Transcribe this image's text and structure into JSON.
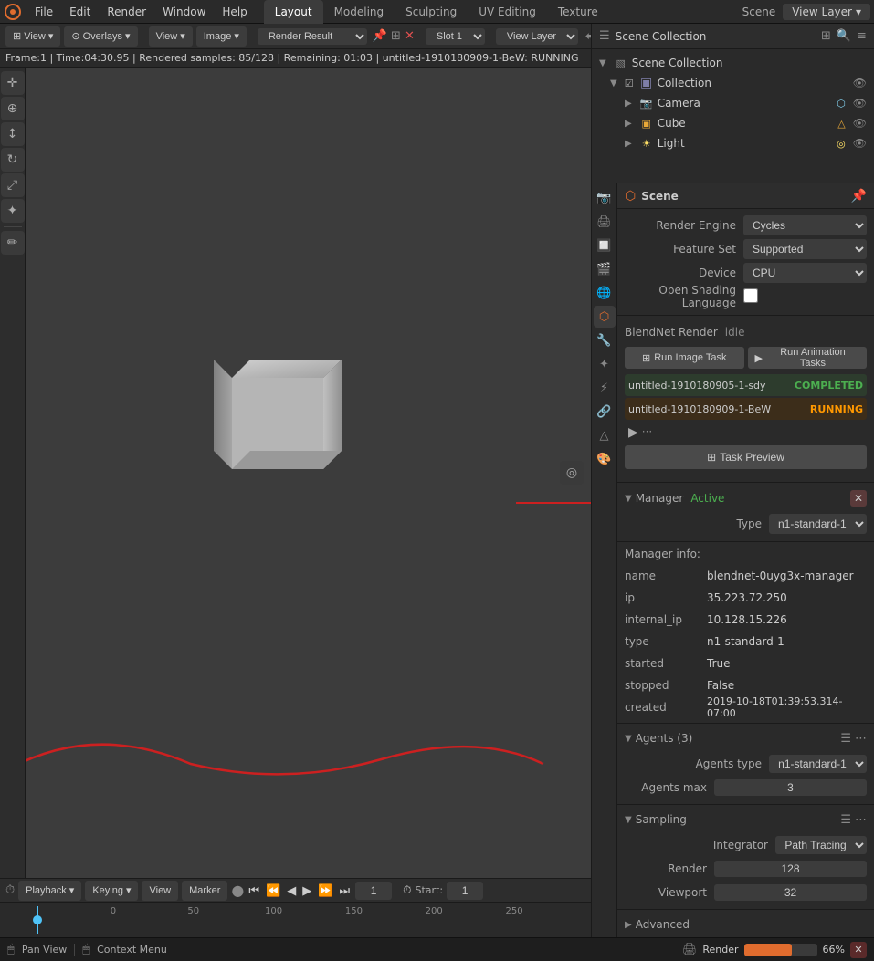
{
  "menubar": {
    "items": [
      "File",
      "Edit",
      "Render",
      "Window",
      "Help"
    ],
    "logo": "⬡",
    "workspaces": [
      {
        "label": "Layout",
        "active": true
      },
      {
        "label": "Modeling"
      },
      {
        "label": "Sculpting"
      },
      {
        "label": "UV Editing"
      },
      {
        "label": "Texture"
      },
      {
        "label": "Scene"
      }
    ],
    "view_layer": "View Layer"
  },
  "viewport": {
    "toolbar": {
      "view_btn": "View",
      "overlays_btn": "Overlays",
      "view_dropdown": "View",
      "image_btn": "Image",
      "render_result": "Render Result",
      "slot": "Slot 1",
      "view_layer": "View Layer"
    },
    "status": "Frame:1 | Time:04:30.95 | Rendered samples: 85/128 | Remaining: 01:03 | untitled-1910180909-1-BeW: RUNNING",
    "icons": [
      "🔲",
      "⚡",
      "🔍",
      "🔆"
    ]
  },
  "outliner": {
    "title": "Scene Collection",
    "items": [
      {
        "level": 1,
        "name": "Collection",
        "icon": "collection",
        "type": "folder"
      },
      {
        "level": 2,
        "name": "Camera",
        "icon": "camera",
        "type": "camera"
      },
      {
        "level": 2,
        "name": "Cube",
        "icon": "cube",
        "type": "mesh"
      },
      {
        "level": 2,
        "name": "Light",
        "icon": "light",
        "type": "light"
      }
    ]
  },
  "properties": {
    "title": "Scene",
    "sections": {
      "render": {
        "engine_label": "Render Engine",
        "engine_value": "Cycles",
        "feature_set_label": "Feature Set",
        "feature_set_value": "Supported",
        "device_label": "Device",
        "device_value": "CPU",
        "osl_label": "Open Shading Language"
      },
      "blendnet": {
        "title": "BlendNet Render",
        "status": "idle",
        "btn_image": "Run Image Task",
        "btn_animation": "Run Animation Tasks",
        "tasks": [
          {
            "name": "untitled-1910180905-1-sdy",
            "status": "COMPLETED",
            "type": "completed"
          },
          {
            "name": "untitled-1910180909-1-BeW",
            "status": "RUNNING",
            "type": "running"
          }
        ],
        "task_preview_btn": "Task Preview"
      },
      "manager": {
        "title": "Manager",
        "status": "Active",
        "type_label": "Type",
        "type_value": "n1-standard-1",
        "info_title": "Manager info:",
        "info": {
          "name": {
            "key": "name",
            "val": "blendnet-0uyg3x-manager"
          },
          "ip": {
            "key": "ip",
            "val": "35.223.72.250"
          },
          "internal_ip": {
            "key": "internal_ip",
            "val": "10.128.15.226"
          },
          "type": {
            "key": "type",
            "val": "n1-standard-1"
          },
          "started": {
            "key": "started",
            "val": "True"
          },
          "stopped": {
            "key": "stopped",
            "val": "False"
          },
          "created": {
            "key": "created",
            "val": "2019-10-18T01:39:53.314-07:00"
          }
        }
      },
      "agents": {
        "title": "Agents (3)",
        "agents_type_label": "Agents type",
        "agents_type_value": "n1-standard-1",
        "agents_max_label": "Agents max",
        "agents_max_value": "3"
      },
      "sampling": {
        "title": "Sampling",
        "integrator_label": "Integrator",
        "integrator_value": "Path Tracing",
        "render_label": "Render",
        "render_value": "128",
        "viewport_label": "Viewport",
        "viewport_value": "32"
      },
      "advanced": {
        "title": "Advanced"
      }
    }
  },
  "timeline": {
    "playback_label": "Playback",
    "keying_label": "Keying",
    "view_label": "View",
    "marker_label": "Marker",
    "frame_current": "1",
    "start": "Start:",
    "start_frame": "1",
    "ticks": [
      "0",
      "50",
      "100",
      "150",
      "200",
      "250"
    ]
  },
  "bottom_status": {
    "pan_view": "Pan View",
    "context_menu": "Context Menu",
    "render_label": "Render",
    "render_progress": "66%",
    "progress_value": 66
  }
}
